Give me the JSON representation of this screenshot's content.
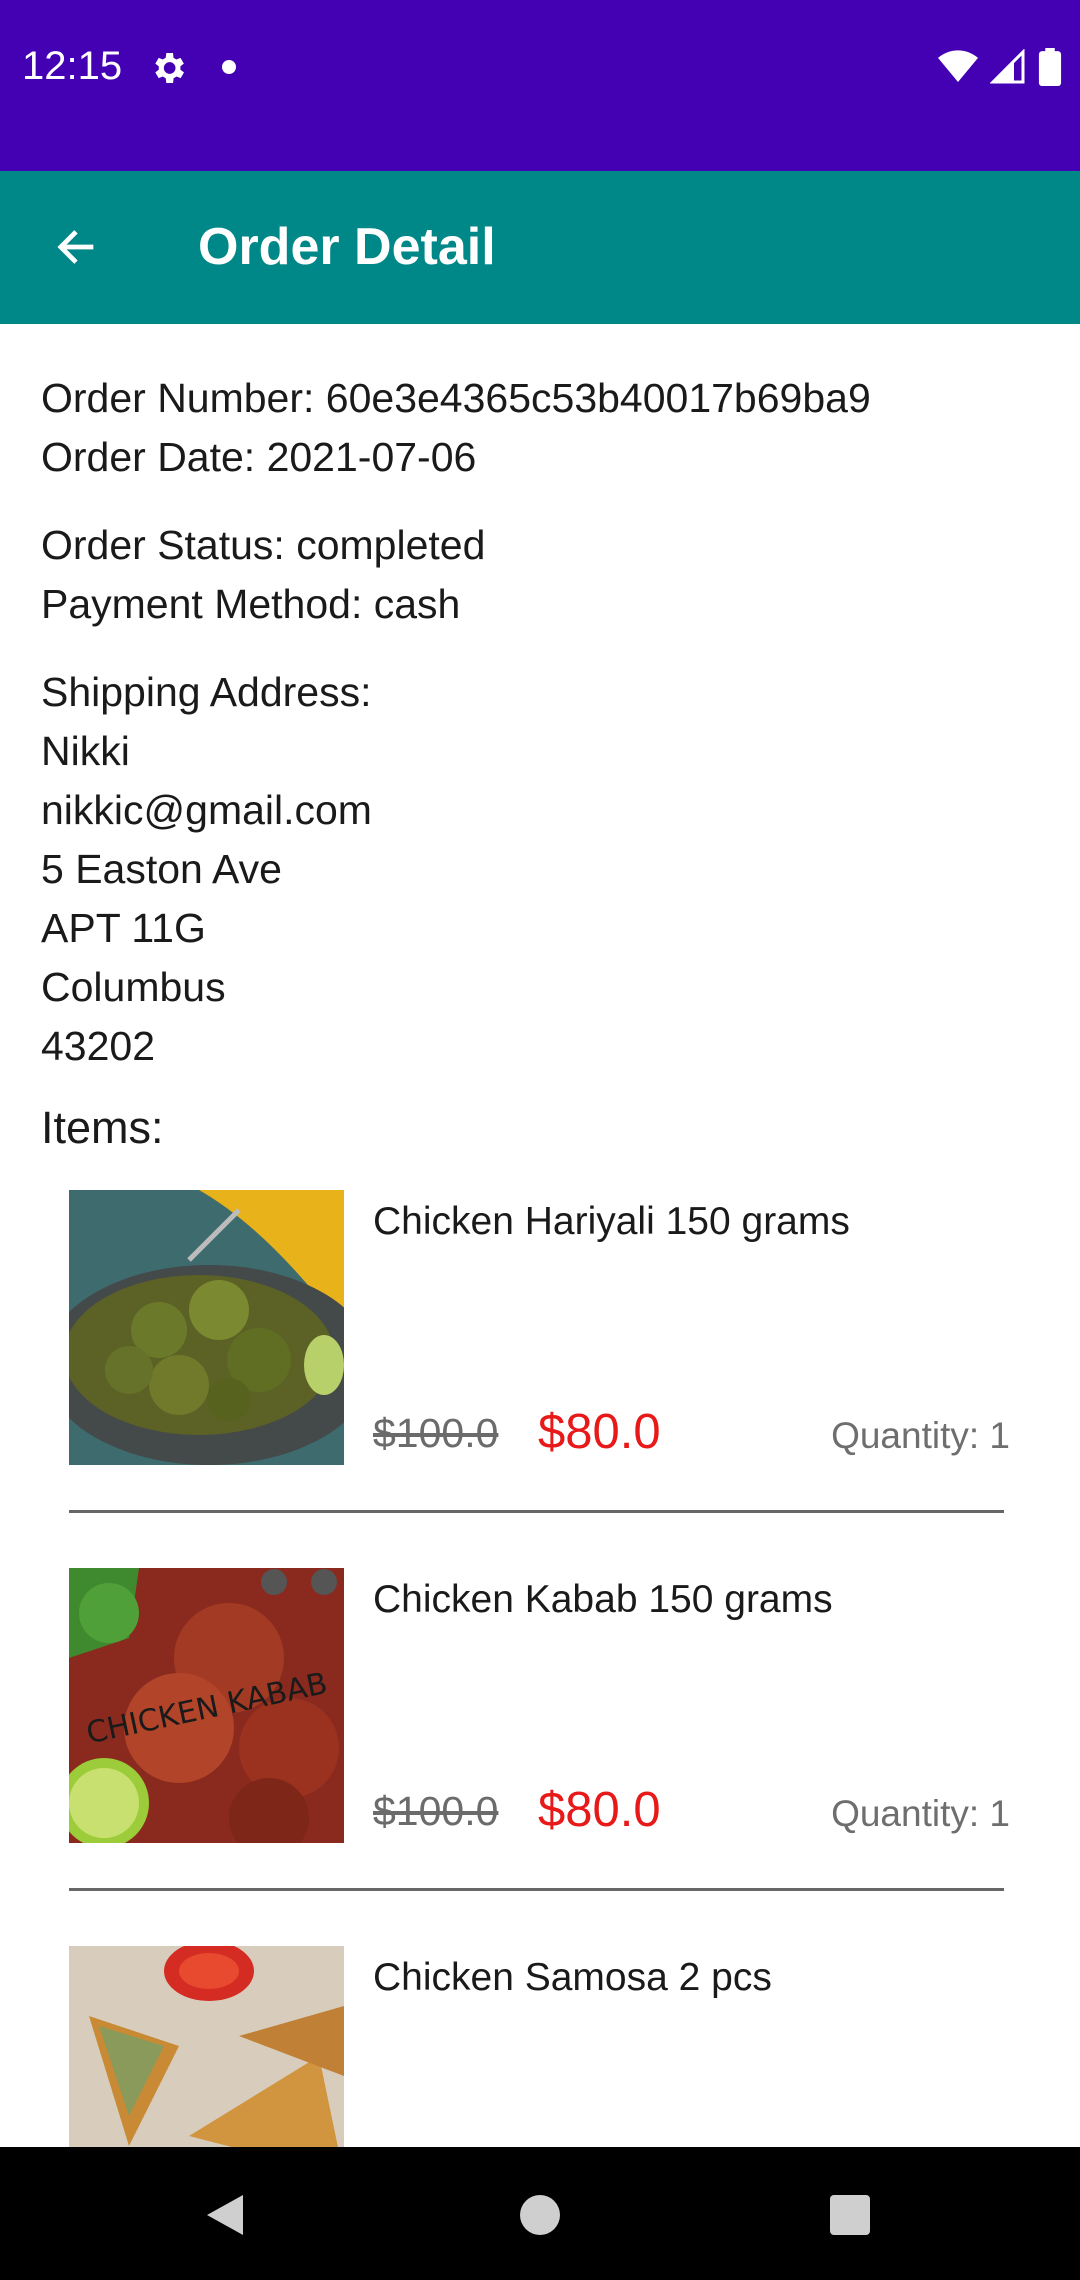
{
  "status_bar": {
    "time": "12:15"
  },
  "app_bar": {
    "title": "Order Detail"
  },
  "order": {
    "number_line": "Order Number: 60e3e4365c53b40017b69ba9",
    "date_line": "Order Date: 2021-07-06",
    "status_line": "Order Status: completed",
    "payment_line": "Payment Method: cash",
    "shipping_label": "Shipping Address:",
    "shipping": {
      "name": "Nikki",
      "email": "nikkic@gmail.com",
      "street": "5 Easton Ave",
      "apt": "APT 11G",
      "city": "Columbus",
      "zip": "43202"
    }
  },
  "items_label": "Items:",
  "items": [
    {
      "name": "Chicken Hariyali 150 grams",
      "old_price": "$100.0",
      "new_price": "$80.0",
      "quantity": "Quantity: 1"
    },
    {
      "name": "Chicken Kabab 150 grams",
      "old_price": "$100.0",
      "new_price": "$80.0",
      "quantity": "Quantity: 1",
      "image_caption": "CHICKEN KABAB"
    },
    {
      "name": "Chicken Samosa 2 pcs"
    }
  ],
  "colors": {
    "status_bar": "#4400b3",
    "app_bar": "#008787",
    "sale_price": "#e81919",
    "nav_bar": "#000000"
  },
  "icons": {
    "back": "arrow-left-icon",
    "settings": "gear-icon",
    "wifi": "wifi-icon",
    "signal": "signal-icon",
    "battery": "battery-icon"
  }
}
